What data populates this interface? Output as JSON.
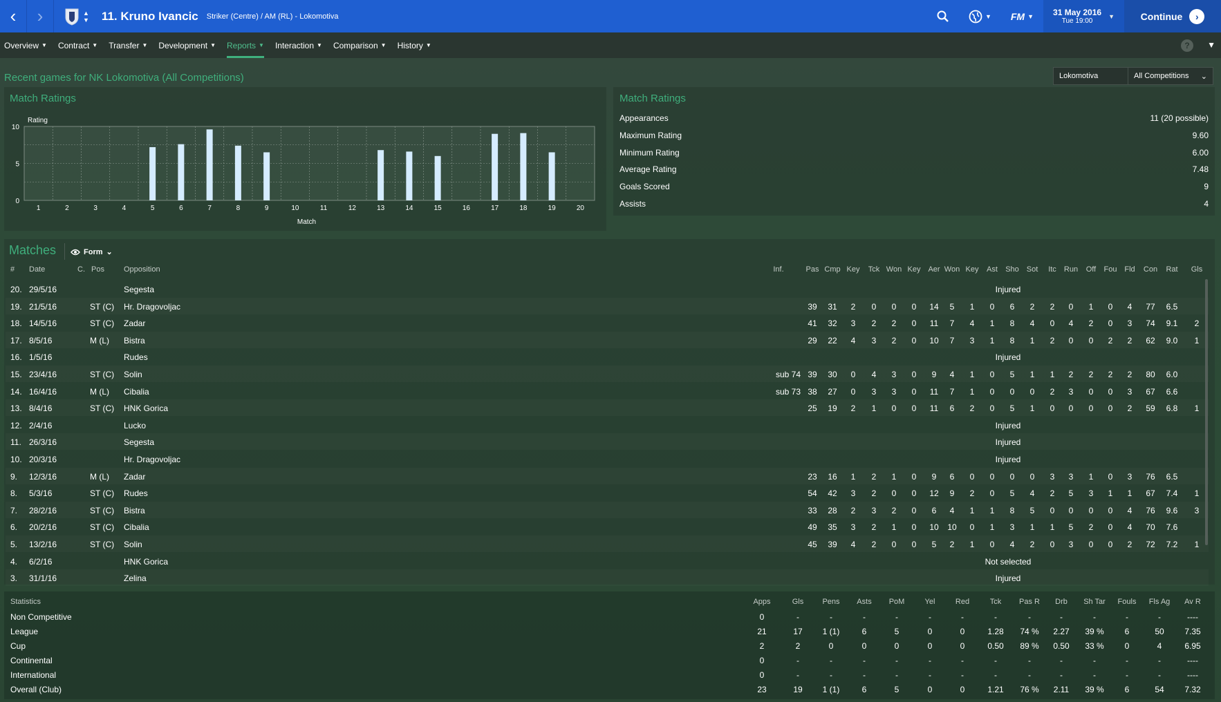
{
  "header": {
    "player_number_name": "11. Kruno Ivancic",
    "position_club": "Striker (Centre) / AM (RL) - Lokomotiva",
    "date": "31 May 2016",
    "time": "Tue 19:00",
    "continue_label": "Continue",
    "fm_label": "FM"
  },
  "menu": [
    "Overview",
    "Contract",
    "Transfer",
    "Development",
    "Reports",
    "Interaction",
    "Comparison",
    "History"
  ],
  "menu_active": "Reports",
  "page_heading": "Recent games for NK Lokomotiva (All Competitions)",
  "filters": {
    "club": "Lokomotiva",
    "competition": "All Competitions"
  },
  "chart_panel_title": "Match Ratings",
  "chart_data": {
    "type": "bar",
    "ylabel": "Rating",
    "xlabel": "Match",
    "ylim": [
      0,
      10
    ],
    "yticks": [
      0,
      5,
      10
    ],
    "categories": [
      "1",
      "2",
      "3",
      "4",
      "5",
      "6",
      "7",
      "8",
      "9",
      "10",
      "11",
      "12",
      "13",
      "14",
      "15",
      "16",
      "17",
      "18",
      "19",
      "20"
    ],
    "values": [
      null,
      null,
      null,
      null,
      7.2,
      7.6,
      9.6,
      7.4,
      6.5,
      null,
      null,
      null,
      6.8,
      6.6,
      6.0,
      null,
      9.0,
      9.1,
      6.5,
      null
    ]
  },
  "ratings_summary": {
    "title": "Match Ratings",
    "rows": [
      {
        "label": "Appearances",
        "value": "11 (20 possible)"
      },
      {
        "label": "Maximum Rating",
        "value": "9.60"
      },
      {
        "label": "Minimum Rating",
        "value": "6.00"
      },
      {
        "label": "Average Rating",
        "value": "7.48"
      },
      {
        "label": "Goals Scored",
        "value": "9"
      },
      {
        "label": "Assists",
        "value": "4"
      }
    ]
  },
  "matches": {
    "title": "Matches",
    "view_label": "Form",
    "columns": [
      "#",
      "Date",
      "C.",
      "Pos",
      "Opposition",
      "Inf.",
      "Pas",
      "Cmp",
      "Key",
      "Tck",
      "Won",
      "Key",
      "Aer",
      "Won",
      "Key",
      "Ast",
      "Sho",
      "Sot",
      "Itc",
      "Run",
      "Off",
      "Fou",
      "Fld",
      "Con",
      "Rat",
      "Gls"
    ],
    "rows": [
      {
        "n": "20.",
        "date": "29/5/16",
        "pos": "",
        "opp": "Segesta",
        "inf": "",
        "note": "Injured",
        "stats": []
      },
      {
        "n": "19.",
        "date": "21/5/16",
        "pos": "ST (C)",
        "opp": "Hr. Dragovoljac",
        "inf": "",
        "note": "",
        "stats": [
          "39",
          "31",
          "2",
          "0",
          "0",
          "0",
          "14",
          "5",
          "1",
          "0",
          "6",
          "2",
          "2",
          "0",
          "1",
          "0",
          "4",
          "77",
          "6.5",
          ""
        ]
      },
      {
        "n": "18.",
        "date": "14/5/16",
        "pos": "ST (C)",
        "opp": "Zadar",
        "inf": "",
        "note": "",
        "stats": [
          "41",
          "32",
          "3",
          "2",
          "2",
          "0",
          "11",
          "7",
          "4",
          "1",
          "8",
          "4",
          "0",
          "4",
          "2",
          "0",
          "3",
          "74",
          "9.1",
          "2"
        ]
      },
      {
        "n": "17.",
        "date": "8/5/16",
        "pos": "M (L)",
        "opp": "Bistra",
        "inf": "",
        "note": "",
        "stats": [
          "29",
          "22",
          "4",
          "3",
          "2",
          "0",
          "10",
          "7",
          "3",
          "1",
          "8",
          "1",
          "2",
          "0",
          "0",
          "2",
          "2",
          "62",
          "9.0",
          "1"
        ]
      },
      {
        "n": "16.",
        "date": "1/5/16",
        "pos": "",
        "opp": "Rudes",
        "inf": "",
        "note": "Injured",
        "stats": []
      },
      {
        "n": "15.",
        "date": "23/4/16",
        "pos": "ST (C)",
        "opp": "Solin",
        "inf": "sub 74",
        "note": "",
        "stats": [
          "39",
          "30",
          "0",
          "4",
          "3",
          "0",
          "9",
          "4",
          "1",
          "0",
          "5",
          "1",
          "1",
          "2",
          "2",
          "2",
          "2",
          "80",
          "6.0",
          ""
        ]
      },
      {
        "n": "14.",
        "date": "16/4/16",
        "pos": "M (L)",
        "opp": "Cibalia",
        "inf": "sub 73",
        "note": "",
        "stats": [
          "38",
          "27",
          "0",
          "3",
          "3",
          "0",
          "11",
          "7",
          "1",
          "0",
          "0",
          "0",
          "2",
          "3",
          "0",
          "0",
          "3",
          "67",
          "6.6",
          ""
        ]
      },
      {
        "n": "13.",
        "date": "8/4/16",
        "pos": "ST (C)",
        "opp": "HNK Gorica",
        "inf": "",
        "note": "",
        "stats": [
          "25",
          "19",
          "2",
          "1",
          "0",
          "0",
          "11",
          "6",
          "2",
          "0",
          "5",
          "1",
          "0",
          "0",
          "0",
          "0",
          "2",
          "59",
          "6.8",
          "1"
        ]
      },
      {
        "n": "12.",
        "date": "2/4/16",
        "pos": "",
        "opp": "Lucko",
        "inf": "",
        "note": "Injured",
        "stats": []
      },
      {
        "n": "11.",
        "date": "26/3/16",
        "pos": "",
        "opp": "Segesta",
        "inf": "",
        "note": "Injured",
        "stats": []
      },
      {
        "n": "10.",
        "date": "20/3/16",
        "pos": "",
        "opp": "Hr. Dragovoljac",
        "inf": "",
        "note": "Injured",
        "stats": []
      },
      {
        "n": "9.",
        "date": "12/3/16",
        "pos": "M (L)",
        "opp": "Zadar",
        "inf": "",
        "note": "",
        "stats": [
          "23",
          "16",
          "1",
          "2",
          "1",
          "0",
          "9",
          "6",
          "0",
          "0",
          "0",
          "0",
          "3",
          "3",
          "1",
          "0",
          "3",
          "76",
          "6.5",
          ""
        ]
      },
      {
        "n": "8.",
        "date": "5/3/16",
        "pos": "ST (C)",
        "opp": "Rudes",
        "inf": "",
        "note": "",
        "stats": [
          "54",
          "42",
          "3",
          "2",
          "0",
          "0",
          "12",
          "9",
          "2",
          "0",
          "5",
          "4",
          "2",
          "5",
          "3",
          "1",
          "1",
          "67",
          "7.4",
          "1"
        ]
      },
      {
        "n": "7.",
        "date": "28/2/16",
        "pos": "ST (C)",
        "opp": "Bistra",
        "inf": "",
        "note": "",
        "stats": [
          "33",
          "28",
          "2",
          "3",
          "2",
          "0",
          "6",
          "4",
          "1",
          "1",
          "8",
          "5",
          "0",
          "0",
          "0",
          "0",
          "4",
          "76",
          "9.6",
          "3"
        ]
      },
      {
        "n": "6.",
        "date": "20/2/16",
        "pos": "ST (C)",
        "opp": "Cibalia",
        "inf": "",
        "note": "",
        "stats": [
          "49",
          "35",
          "3",
          "2",
          "1",
          "0",
          "10",
          "10",
          "0",
          "1",
          "3",
          "1",
          "1",
          "5",
          "2",
          "0",
          "4",
          "70",
          "7.6",
          ""
        ]
      },
      {
        "n": "5.",
        "date": "13/2/16",
        "pos": "ST (C)",
        "opp": "Solin",
        "inf": "",
        "note": "",
        "stats": [
          "45",
          "39",
          "4",
          "2",
          "0",
          "0",
          "5",
          "2",
          "1",
          "0",
          "4",
          "2",
          "0",
          "3",
          "0",
          "0",
          "2",
          "72",
          "7.2",
          "1"
        ]
      },
      {
        "n": "4.",
        "date": "6/2/16",
        "pos": "",
        "opp": "HNK Gorica",
        "inf": "",
        "note": "Not selected",
        "stats": []
      },
      {
        "n": "3.",
        "date": "31/1/16",
        "pos": "",
        "opp": "Zelina",
        "inf": "",
        "note": "Injured",
        "stats": []
      }
    ]
  },
  "statistics": {
    "title": "Statistics",
    "columns": [
      "Apps",
      "Gls",
      "Pens",
      "Asts",
      "PoM",
      "Yel",
      "Red",
      "Tck",
      "Pas R",
      "Drb",
      "Sh Tar",
      "Fouls",
      "Fls Ag",
      "Av R"
    ],
    "rows": [
      {
        "label": "Non Competitive",
        "values": [
          "0",
          "-",
          "-",
          "-",
          "-",
          "-",
          "-",
          "-",
          "-",
          "-",
          "-",
          "-",
          "-",
          "----"
        ]
      },
      {
        "label": "League",
        "values": [
          "21",
          "17",
          "1 (1)",
          "6",
          "5",
          "0",
          "0",
          "1.28",
          "74 %",
          "2.27",
          "39 %",
          "6",
          "50",
          "7.35"
        ]
      },
      {
        "label": "Cup",
        "values": [
          "2",
          "2",
          "0",
          "0",
          "0",
          "0",
          "0",
          "0.50",
          "89 %",
          "0.50",
          "33 %",
          "0",
          "4",
          "6.95"
        ]
      },
      {
        "label": "Continental",
        "values": [
          "0",
          "-",
          "-",
          "-",
          "-",
          "-",
          "-",
          "-",
          "-",
          "-",
          "-",
          "-",
          "-",
          "----"
        ]
      },
      {
        "label": "International",
        "values": [
          "0",
          "-",
          "-",
          "-",
          "-",
          "-",
          "-",
          "-",
          "-",
          "-",
          "-",
          "-",
          "-",
          "----"
        ]
      },
      {
        "label": "Overall (Club)",
        "values": [
          "23",
          "19",
          "1 (1)",
          "6",
          "5",
          "0",
          "0",
          "1.21",
          "76 %",
          "2.11",
          "39 %",
          "6",
          "54",
          "7.32"
        ]
      }
    ]
  },
  "colors": {
    "accent": "#3fae7c",
    "topbar": "#1f5fd1",
    "bar": "#d5ecff"
  }
}
